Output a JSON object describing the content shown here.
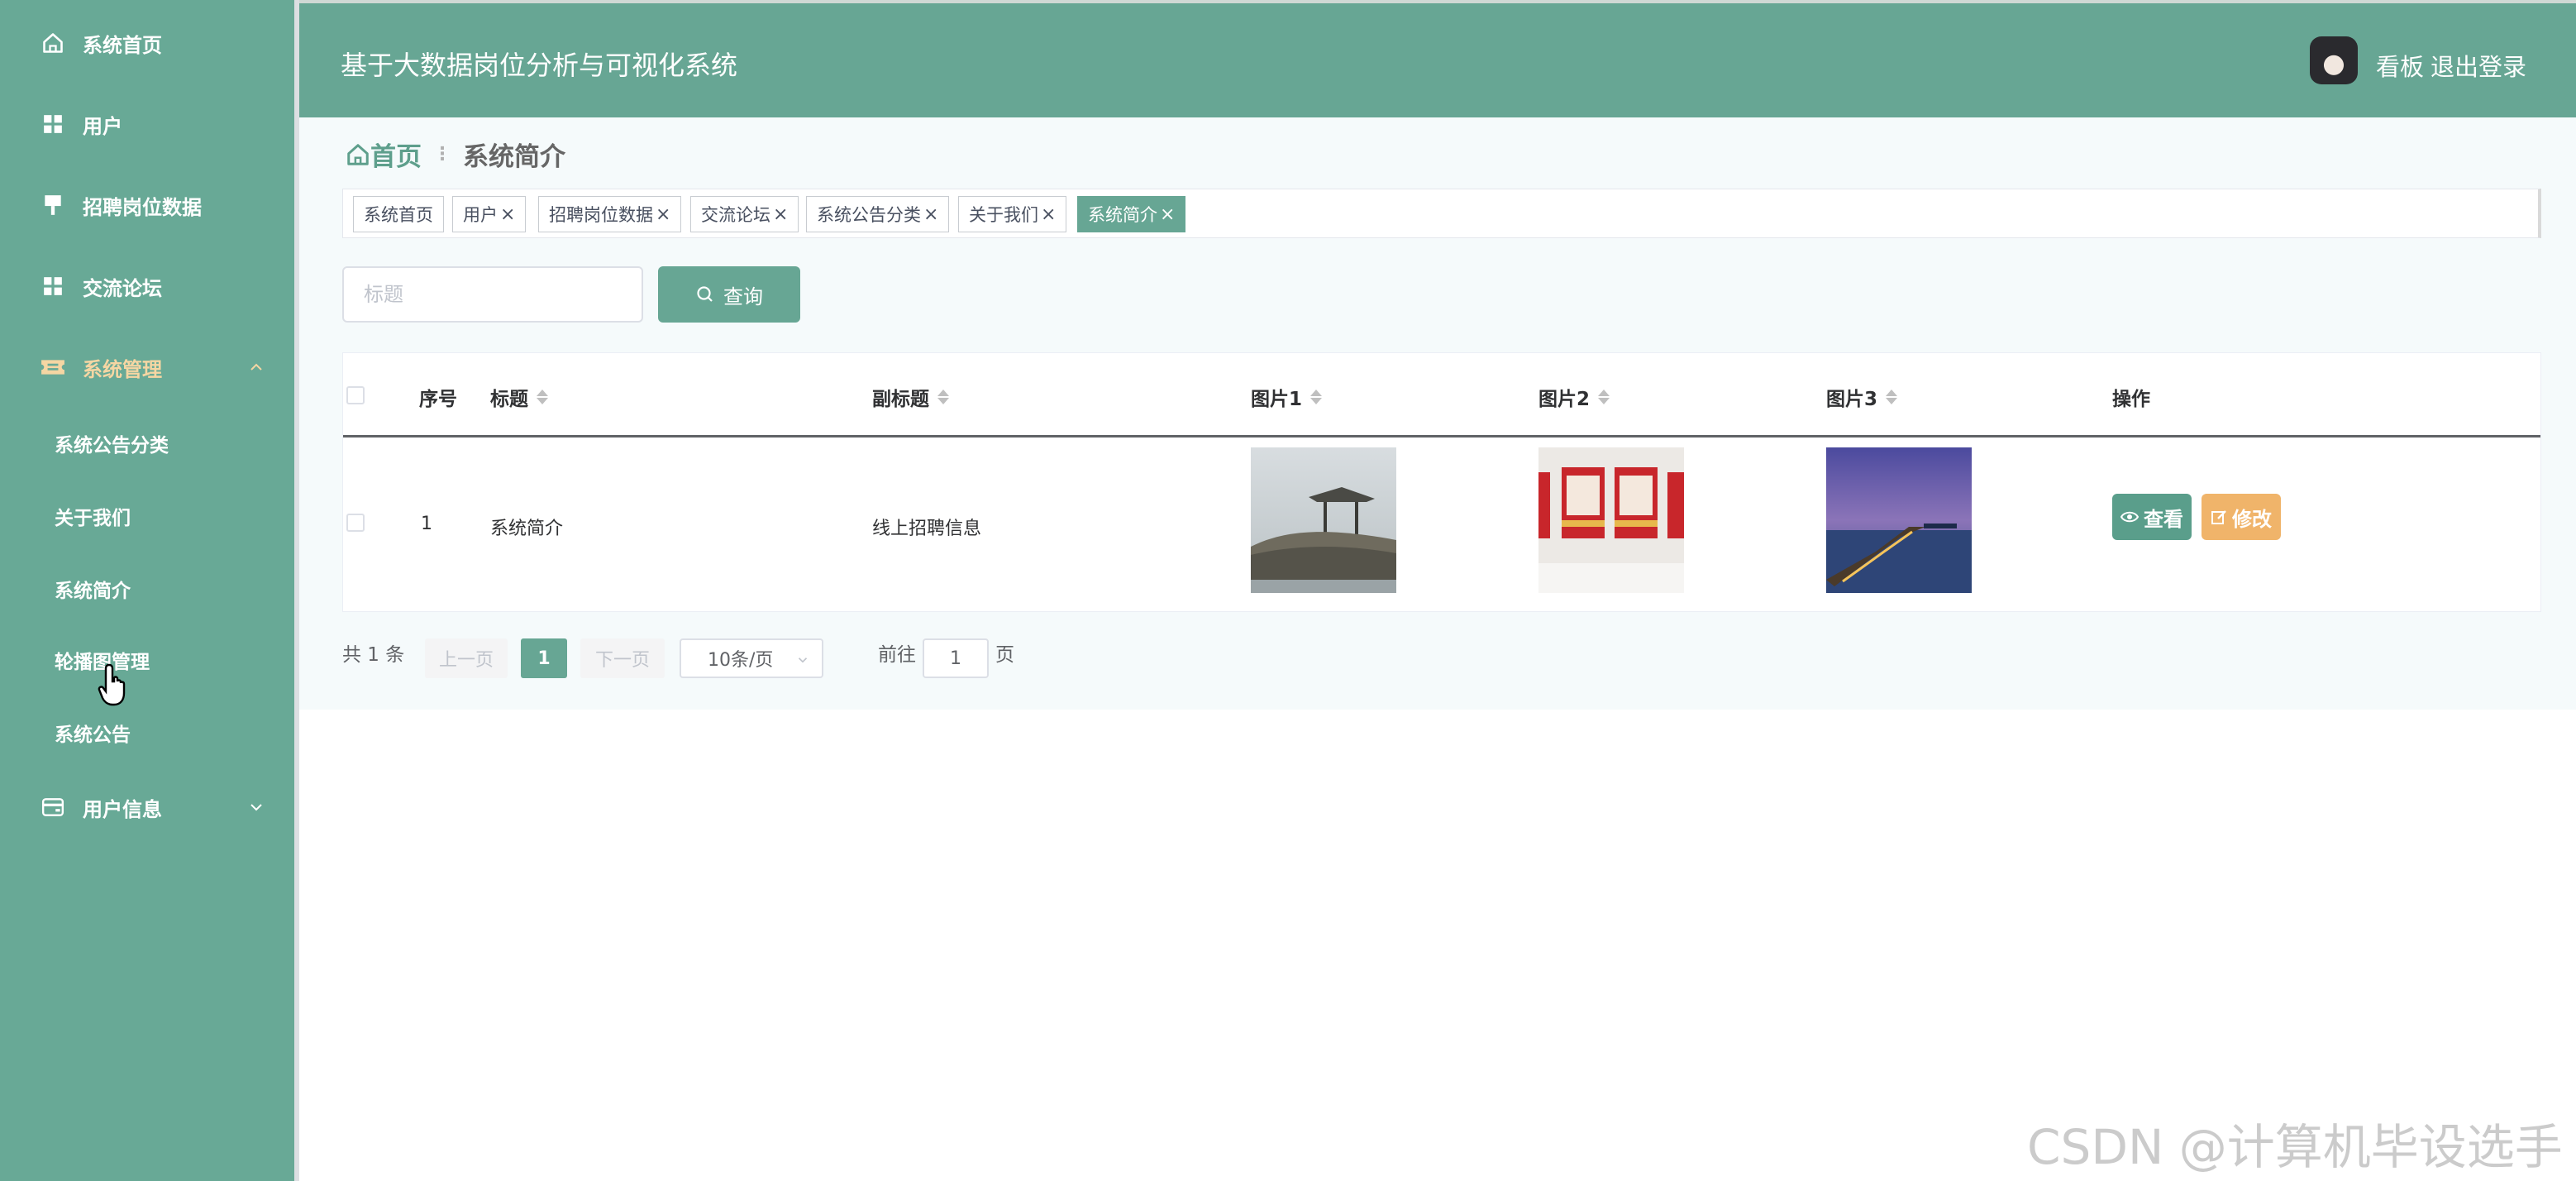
{
  "app": {
    "title": "基于大数据岗位分析与可视化系统"
  },
  "header": {
    "user": "看板",
    "logout": "退出登录"
  },
  "sidebar": {
    "items": [
      {
        "label": "系统首页",
        "icon": "home-icon"
      },
      {
        "label": "用户",
        "icon": "grid-icon"
      },
      {
        "label": "招聘岗位数据",
        "icon": "flag-icon"
      },
      {
        "label": "交流论坛",
        "icon": "grid-icon"
      },
      {
        "label": "系统管理",
        "icon": "ticket-icon"
      },
      {
        "label": "用户信息",
        "icon": "wallet-icon"
      }
    ],
    "submenu": [
      {
        "label": "系统公告分类"
      },
      {
        "label": "关于我们"
      },
      {
        "label": "系统简介"
      },
      {
        "label": "轮播图管理"
      },
      {
        "label": "系统公告"
      }
    ]
  },
  "breadcrumb": {
    "home": "首页",
    "current": "系统简介"
  },
  "tags": [
    {
      "label": "系统首页"
    },
    {
      "label": "用户"
    },
    {
      "label": "招聘岗位数据"
    },
    {
      "label": "交流论坛"
    },
    {
      "label": "系统公告分类"
    },
    {
      "label": "关于我们"
    },
    {
      "label": "系统简介"
    }
  ],
  "search": {
    "placeholder": "标题",
    "button": "查询"
  },
  "table": {
    "headers": [
      "序号",
      "标题",
      "副标题",
      "图片1",
      "图片2",
      "图片3",
      "操作"
    ],
    "rows": [
      {
        "index": "1",
        "title": "系统简介",
        "subtitle": "线上招聘信息"
      }
    ],
    "actions": {
      "view": "查看",
      "edit": "修改"
    }
  },
  "pagination": {
    "total": "共 1 条",
    "prev": "上一页",
    "page": "1",
    "next": "下一页",
    "page_size": "10条/页",
    "goto_prefix": "前往",
    "goto_value": "1",
    "goto_suffix": "页"
  },
  "watermark": "CSDN @计算机毕设选手",
  "colors": {
    "primary": "#67a694",
    "sidebar": "#68a996",
    "warning": "#f0b46a",
    "active_menu": "#f5d6a3"
  }
}
